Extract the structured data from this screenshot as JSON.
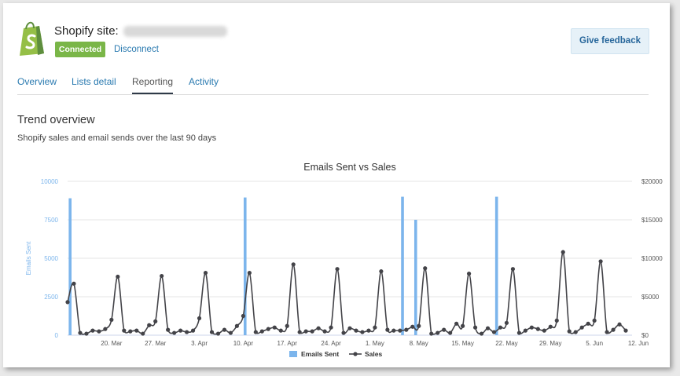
{
  "header": {
    "site_label": "Shopify site:",
    "status": "Connected",
    "disconnect": "Disconnect",
    "feedback": "Give feedback"
  },
  "tabs": [
    {
      "label": "Overview",
      "active": false
    },
    {
      "label": "Lists detail",
      "active": false
    },
    {
      "label": "Reporting",
      "active": true
    },
    {
      "label": "Activity",
      "active": false
    }
  ],
  "section": {
    "title": "Trend overview",
    "subtitle": "Shopify sales and email sends over the last 90 days"
  },
  "colors": {
    "brand_green": "#7ab648",
    "link": "#2a7ab0",
    "bar": "#7cb5ec",
    "line": "#434348"
  },
  "chart_data": {
    "type": "bar",
    "title": "Emails Sent vs Sales",
    "ylabel": "Emails Sent",
    "ylim": [
      0,
      10000
    ],
    "y2lim": [
      0,
      20000
    ],
    "yticks": [
      "0",
      "2500",
      "5000",
      "7500",
      "10000"
    ],
    "y2ticks": [
      "$0",
      "$5000",
      "$10000",
      "$15000",
      "$20000"
    ],
    "xlim": [
      0,
      90
    ],
    "x_ticks": [
      {
        "x": 7,
        "label": "20. Mar"
      },
      {
        "x": 14,
        "label": "27. Mar"
      },
      {
        "x": 21,
        "label": "3. Apr"
      },
      {
        "x": 28,
        "label": "10. Apr"
      },
      {
        "x": 35,
        "label": "17. Apr"
      },
      {
        "x": 42,
        "label": "24. Apr"
      },
      {
        "x": 49,
        "label": "1. May"
      },
      {
        "x": 56,
        "label": "8. May"
      },
      {
        "x": 63,
        "label": "15. May"
      },
      {
        "x": 70,
        "label": "22. May"
      },
      {
        "x": 77,
        "label": "29. May"
      },
      {
        "x": 84,
        "label": "5. Jun"
      },
      {
        "x": 91,
        "label": "12. Jun"
      }
    ],
    "series": [
      {
        "name": "Emails Sent",
        "type": "bar",
        "x": [
          0.4,
          28.3,
          53.4,
          55.5,
          68.4
        ],
        "values": [
          8900,
          8950,
          9000,
          7500,
          9000
        ]
      },
      {
        "name": "Sales",
        "type": "line",
        "x": [
          0,
          1,
          2,
          3,
          4,
          5,
          6,
          7,
          8,
          9,
          10,
          11,
          12,
          13,
          14,
          15,
          16,
          17,
          18,
          19,
          20,
          21,
          22,
          23,
          24,
          25,
          26,
          27,
          28,
          29,
          30,
          31,
          32,
          33,
          34,
          35,
          36,
          37,
          38,
          39,
          40,
          41,
          42,
          43,
          44,
          45,
          46,
          47,
          48,
          49,
          50,
          51,
          52,
          53,
          54,
          55,
          56,
          57,
          58,
          59,
          60,
          61,
          62,
          63,
          64,
          65,
          66,
          67,
          68,
          69,
          70,
          71,
          72,
          73,
          74,
          75,
          76,
          77,
          78,
          79,
          80,
          81,
          82,
          83,
          84,
          85,
          86,
          87,
          88,
          89
        ],
        "values": [
          4300,
          6700,
          300,
          200,
          600,
          500,
          800,
          2000,
          7600,
          600,
          500,
          600,
          200,
          1300,
          1800,
          7700,
          700,
          300,
          600,
          400,
          600,
          2200,
          8100,
          400,
          200,
          700,
          300,
          1200,
          2500,
          8100,
          400,
          500,
          800,
          1000,
          600,
          1200,
          9200,
          400,
          500,
          500,
          900,
          500,
          1000,
          8600,
          300,
          900,
          600,
          400,
          600,
          1000,
          8300,
          700,
          600,
          600,
          700,
          1100,
          1200,
          8700,
          200,
          300,
          700,
          300,
          1500,
          1200,
          8000,
          1000,
          200,
          900,
          400,
          1000,
          1600,
          8600,
          300,
          600,
          1000,
          800,
          600,
          1100,
          1900,
          10800,
          500,
          400,
          1000,
          1500,
          1900,
          9600,
          400,
          700,
          1400,
          600
        ]
      }
    ],
    "legend": "bottom"
  }
}
